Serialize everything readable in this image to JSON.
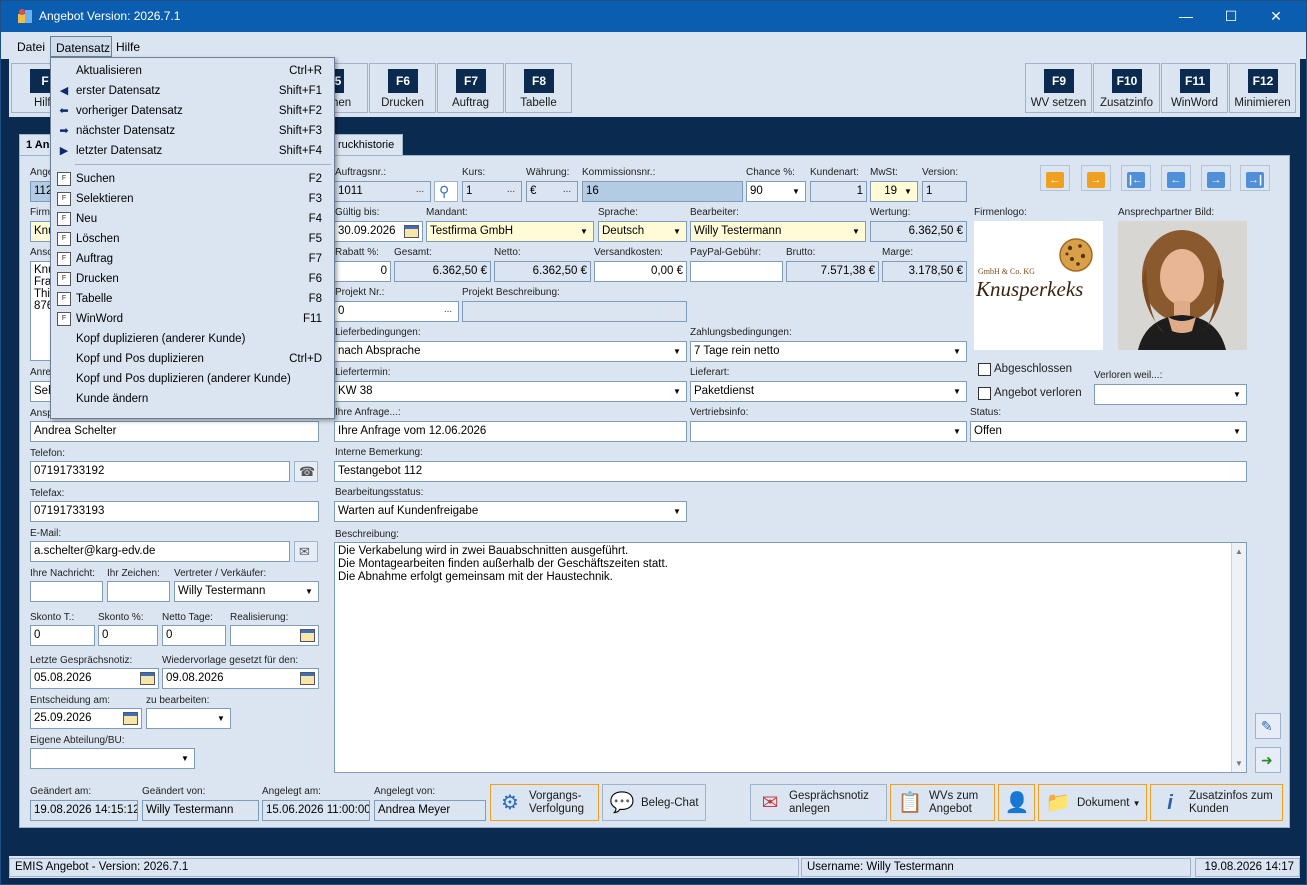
{
  "window": {
    "title": "Angebot Version: 2026.7.1"
  },
  "menu": {
    "file": "Datei",
    "record": "Datensatz",
    "help": "Hilfe"
  },
  "toolbar": {
    "left_partial_label": "Hilf",
    "f5_label": "hen",
    "keys": [
      {
        "key": "F6",
        "label": "Drucken"
      },
      {
        "key": "F7",
        "label": "Auftrag"
      },
      {
        "key": "F8",
        "label": "Tabelle"
      },
      {
        "key": "F9",
        "label": "WV setzen"
      },
      {
        "key": "F10",
        "label": "Zusatzinfo"
      },
      {
        "key": "F11",
        "label": "WinWord"
      },
      {
        "key": "F12",
        "label": "Minimieren"
      }
    ],
    "f1_key": "F",
    "f5_key": "5"
  },
  "tabs": {
    "first": "1 An",
    "second": "ruckhistorie"
  },
  "dropdown": {
    "items": [
      {
        "label": "Aktualisieren",
        "key": "Ctrl+R",
        "icon": "none"
      },
      {
        "label": "erster Datensatz",
        "key": "Shift+F1",
        "icon": "first-arrow"
      },
      {
        "label": "vorheriger Datensatz",
        "key": "Shift+F2",
        "icon": "left-arrow"
      },
      {
        "label": "nächster Datensatz",
        "key": "Shift+F3",
        "icon": "right-arrow"
      },
      {
        "label": "letzter Datensatz",
        "key": "Shift+F4",
        "icon": "last-arrow"
      },
      {
        "label": "Suchen",
        "key": "F2",
        "icon": "doc"
      },
      {
        "label": "Selektieren",
        "key": "F3",
        "icon": "doc"
      },
      {
        "label": "Neu",
        "key": "F4",
        "icon": "doc"
      },
      {
        "label": "Löschen",
        "key": "F5",
        "icon": "doc"
      },
      {
        "label": "Auftrag",
        "key": "F7",
        "icon": "doc"
      },
      {
        "label": "Drucken",
        "key": "F6",
        "icon": "doc"
      },
      {
        "label": "Tabelle",
        "key": "F8",
        "icon": "doc"
      },
      {
        "label": "WinWord",
        "key": "F11",
        "icon": "doc"
      },
      {
        "label": "Kopf duplizieren (anderer Kunde)",
        "key": "",
        "icon": "none"
      },
      {
        "label": "Kopf und Pos duplizieren",
        "key": "Ctrl+D",
        "icon": "none"
      },
      {
        "label": "Kopf und Pos duplizieren (anderer Kunde)",
        "key": "",
        "icon": "none"
      },
      {
        "label": "Kunde ändern",
        "key": "",
        "icon": "none"
      }
    ],
    "doc_icon_text": "F"
  },
  "left": {
    "partial_labels": [
      "Ange",
      "Firm",
      "Ansc",
      "Anre",
      "Ansp"
    ],
    "partial_values": [
      "112",
      "Knu",
      "Sehr"
    ],
    "address_lines": [
      "Knu",
      "Frau",
      "Thir",
      "876"
    ],
    "contact_label": "Ansprechpartner:",
    "contact": "Andrea Schelter",
    "phone_label": "Telefon:",
    "phone": "07191733192",
    "fax_label": "Telefax:",
    "fax": "07191733193",
    "email_label": "E-Mail:",
    "email": "a.schelter@karg-edv.de",
    "your_message_label": "Ihre Nachricht:",
    "your_sign_label": "Ihr Zeichen:",
    "rep_label": "Vertreter / Verkäufer:",
    "rep": "Willy Testermann",
    "skonto_days_label": "Skonto T.:",
    "skonto_days": "0",
    "skonto_pct_label": "Skonto %:",
    "skonto_pct": "0",
    "net_days_label": "Netto Tage:",
    "net_days": "0",
    "realization_label": "Realisierung:",
    "last_note_label": "Letzte Gesprächsnotiz:",
    "last_note": "05.08.2026",
    "followup_label": "Wiedervorlage gesetzt für den:",
    "followup": "09.08.2026",
    "decision_label": "Entscheidung am:",
    "decision": "25.09.2026",
    "to_edit_label": "zu bearbeiten:",
    "dept_label": "Eigene Abteilung/BU:"
  },
  "main": {
    "order_no_label": "Auftragsnr.:",
    "order_no": "1011",
    "rate_label": "Kurs:",
    "rate": "1",
    "currency_label": "Währung:",
    "currency": "€",
    "commission_label": "Kommissionsnr.:",
    "commission": "16",
    "chance_label": "Chance %:",
    "chance": "90",
    "customer_type_label": "Kundenart:",
    "customer_type": "1",
    "vat_label": "MwSt:",
    "vat": "19",
    "version_label": "Version:",
    "version": "1",
    "valid_label": "Gültig bis:",
    "valid": "30.09.2026",
    "client_label": "Mandant:",
    "client": "Testfirma GmbH",
    "language_label": "Sprache:",
    "language": "Deutsch",
    "editor_label": "Bearbeiter:",
    "editor": "Willy Testermann",
    "rating_label": "Wertung:",
    "rating": "6.362,50 €",
    "discount_label": "Rabatt %:",
    "discount": "0",
    "total_label": "Gesamt:",
    "total": "6.362,50 €",
    "net_label": "Netto:",
    "net": "6.362,50 €",
    "shipping_label": "Versandkosten:",
    "shipping": "0,00 €",
    "paypal_label": "PayPal-Gebühr:",
    "gross_label": "Brutto:",
    "gross": "7.571,38 €",
    "margin_label": "Marge:",
    "margin": "3.178,50 €",
    "project_no_label": "Projekt Nr.:",
    "project_no": "0",
    "project_desc_label": "Projekt Beschreibung:",
    "delivery_terms_label": "Lieferbedingungen:",
    "delivery_terms": "nach Absprache",
    "payment_terms_label": "Zahlungsbedingungen:",
    "payment_terms": "7 Tage rein netto",
    "delivery_date_label": "Liefertermin:",
    "delivery_date": "KW 38",
    "delivery_type_label": "Lieferart:",
    "delivery_type": "Paketdienst",
    "inquiry_label": "Ihre Anfrage...:",
    "inquiry": "Ihre Anfrage vom 12.06.2026",
    "sales_info_label": "Vertriebsinfo:",
    "status_label": "Status:",
    "status": "Offen",
    "internal_note_label": "Interne Bemerkung:",
    "internal_note": "Testangebot 112",
    "processing_status_label": "Bearbeitungsstatus:",
    "processing_status": "Warten auf Kundenfreigabe",
    "description_label": "Beschreibung:",
    "description_lines": [
      "Die Verkabelung wird in zwei Bauabschnitten ausgeführt.",
      "Die Montagearbeiten finden außerhalb der Geschäftszeiten statt.",
      "Die Abnahme erfolgt gemeinsam mit der Haustechnik."
    ],
    "logo_label": "Firmenlogo:",
    "logo_small": "GmbH & Co. KG",
    "logo_text": "Knusperkeks",
    "contact_pic_label": "Ansprechpartner Bild:",
    "closed_label": "Abgeschlossen",
    "lost_label": "Angebot verloren",
    "lost_why_label": "Verloren weil...:"
  },
  "footer": {
    "changed_at_label": "Geändert am:",
    "changed_at": "19.08.2026 14:15:12",
    "changed_by_label": "Geändert von:",
    "changed_by": "Willy Testermann",
    "created_at_label": "Angelegt am:",
    "created_at": "15.06.2026 11:00:00",
    "created_by_label": "Angelegt von:",
    "created_by": "Andrea Meyer",
    "btn_tracking": [
      "Vorgangs-",
      "Verfolgung"
    ],
    "btn_chat": "Beleg-Chat",
    "btn_note": [
      "Gesprächsnotiz",
      "anlegen"
    ],
    "btn_wv": [
      "WVs zum",
      "Angebot"
    ],
    "btn_document": "Dokument",
    "btn_info": [
      "Zusatzinfos zum",
      "Kunden"
    ]
  },
  "statusbar": {
    "app": "EMIS Angebot - Version: 2026.7.1",
    "user": "Username: Willy Testermann",
    "datetime": "19.08.2026 14:17"
  },
  "colors": {
    "accent": "#f0a020",
    "frame": "#0b2a4f",
    "panel": "#dbe5f1"
  }
}
